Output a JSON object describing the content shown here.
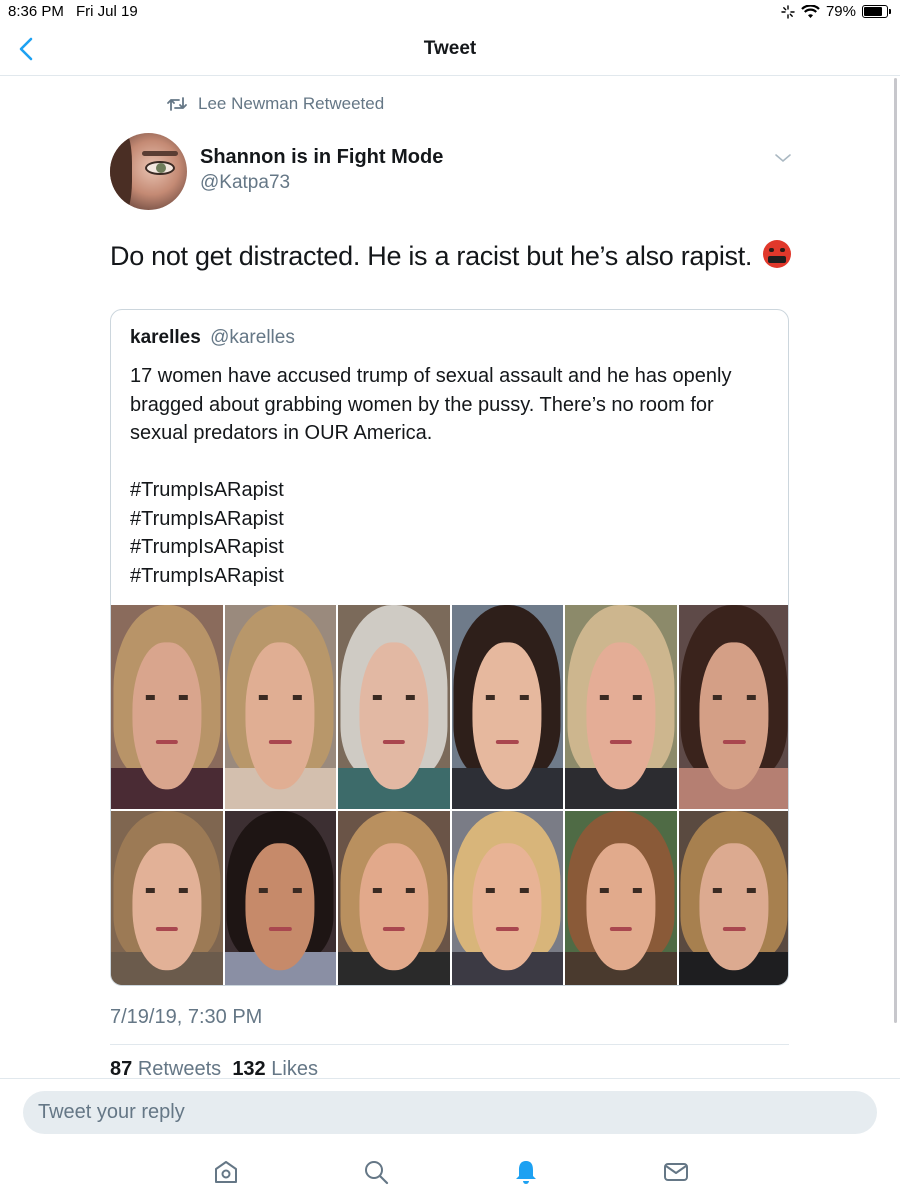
{
  "status_bar": {
    "time": "8:36 PM",
    "date": "Fri Jul 19",
    "battery": "79%"
  },
  "nav": {
    "title": "Tweet"
  },
  "retweet": {
    "text": "Lee Newman Retweeted"
  },
  "author": {
    "name": "Shannon is in Fight Mode",
    "handle": "@Katpa73"
  },
  "tweet": {
    "text": "Do not get distracted. He is a racist but he’s also rapist. "
  },
  "quote": {
    "name": "karelles",
    "handle": "@karelles",
    "text": "17 women have accused trump of sexual assault and he has openly bragged about grabbing women by the pussy. There’s no room for sexual predators in OUR America.",
    "hashtags": [
      "#TrumpIsARapist",
      "#TrumpIsARapist",
      "#TrumpIsARapist",
      "#TrumpIsARapist"
    ]
  },
  "photos": [
    {
      "bg": "#8a6b5c",
      "hair": "#b89468",
      "skin": "#d9a58d",
      "clothes": "#4a2b34"
    },
    {
      "bg": "#9a8a7d",
      "hair": "#b8976a",
      "skin": "#e0ae93",
      "clothes": "#d3bfae"
    },
    {
      "bg": "#7b6a5a",
      "hair": "#cfcbc4",
      "skin": "#e2b8a3",
      "clothes": "#3d6b6a"
    },
    {
      "bg": "#6f7b8a",
      "hair": "#2e1f1a",
      "skin": "#e6b89e",
      "clothes": "#2d2f36"
    },
    {
      "bg": "#8c8a6a",
      "hair": "#cdb68e",
      "skin": "#e4ad96",
      "clothes": "#2c2c30"
    },
    {
      "bg": "#5e4a48",
      "hair": "#3a231c",
      "skin": "#d49f86",
      "clothes": "#b57f72"
    },
    {
      "bg": "#7f6650",
      "hair": "#9c7a55",
      "skin": "#e2b197",
      "clothes": "#6b5b4c"
    },
    {
      "bg": "#3c2f32",
      "hair": "#1e1514",
      "skin": "#c68a6a",
      "clothes": "#8a8fa4"
    },
    {
      "bg": "#6a5447",
      "hair": "#b9905f",
      "skin": "#e2a98b",
      "clothes": "#2a2a2a"
    },
    {
      "bg": "#7a7c86",
      "hair": "#d8b57a",
      "skin": "#e8b395",
      "clothes": "#3c3a44"
    },
    {
      "bg": "#4f6b45",
      "hair": "#8a5a38",
      "skin": "#e1aa8c",
      "clothes": "#4a3a2e"
    },
    {
      "bg": "#5a4a40",
      "hair": "#a7804f",
      "skin": "#dcaa90",
      "clothes": "#1e1e20"
    }
  ],
  "timestamp": "7/19/19, 7:30 PM",
  "stats": {
    "retweets_count": "87",
    "retweets_label": "Retweets",
    "likes_count": "132",
    "likes_label": "Likes"
  },
  "reply": {
    "placeholder": "Tweet your reply"
  },
  "colors": {
    "accent": "#1da1f2",
    "secondary_text": "#657786",
    "border": "#e1e8ed"
  },
  "icons": [
    "chevron-left-icon",
    "retweet-icon",
    "chevron-down-icon",
    "home-icon",
    "search-icon",
    "notifications-icon",
    "messages-icon",
    "wifi-icon",
    "battery-icon",
    "angry-face-emoji"
  ]
}
